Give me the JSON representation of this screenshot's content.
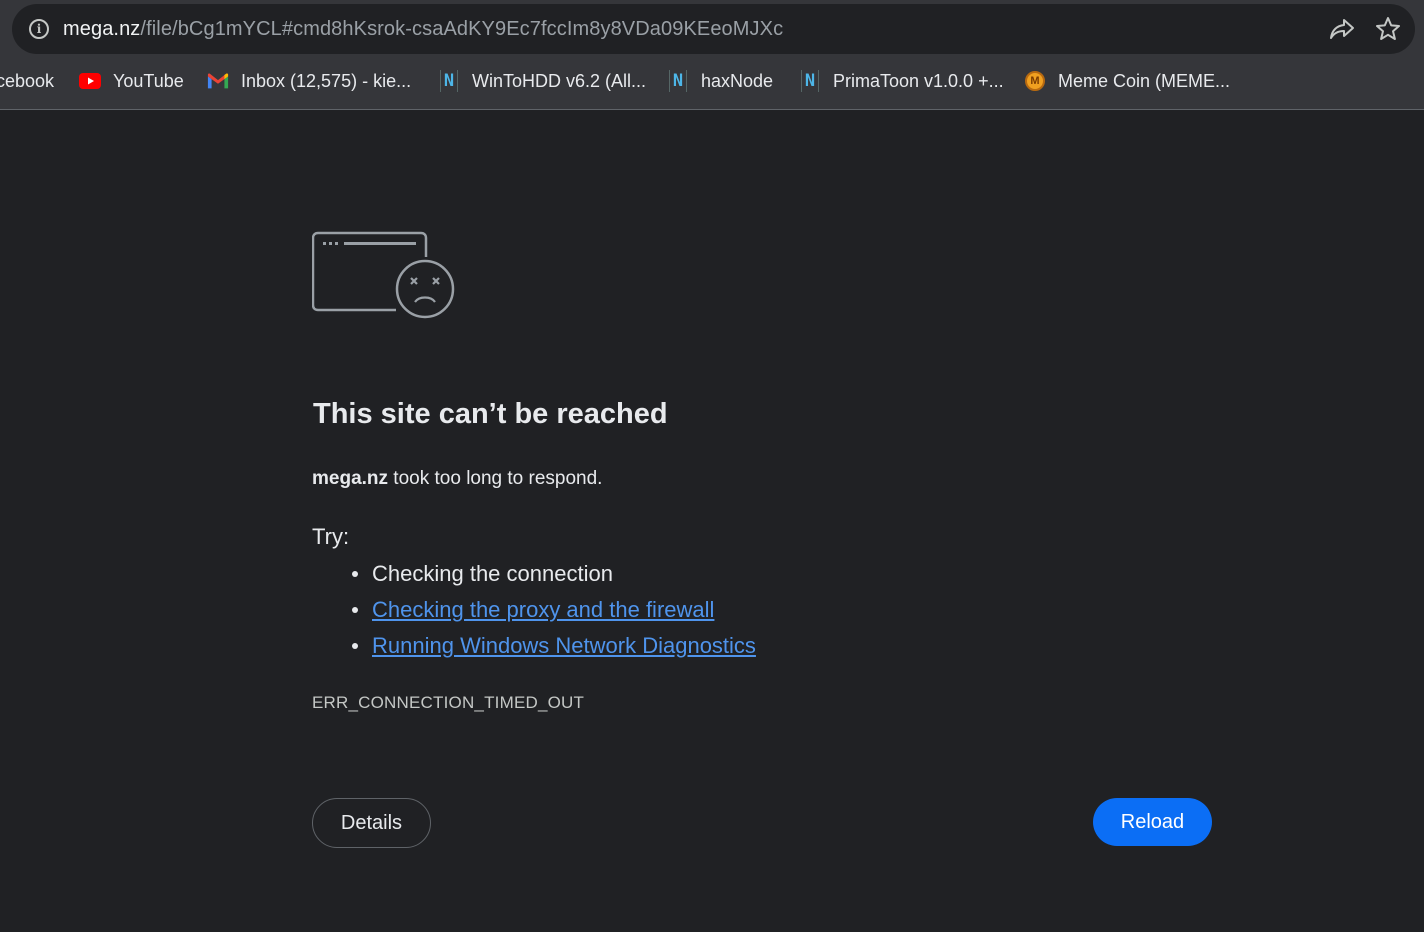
{
  "browser": {
    "url_host": "mega.nz",
    "url_path": "/file/bCg1mYCL#cmd8hKsrok-csaAdKY9Ec7fccIm8y8VDa09KEeoMJXc",
    "icons": {
      "site_info": "info-icon",
      "share": "share-icon",
      "bookmark_star": "star-icon"
    }
  },
  "bookmarks": [
    {
      "label": "cebook",
      "icon": "none"
    },
    {
      "label": "YouTube",
      "icon": "youtube-icon"
    },
    {
      "label": "Inbox (12,575) - kie...",
      "icon": "gmail-icon"
    },
    {
      "label": "WinToHDD v6.2 (All...",
      "icon": "n-icon"
    },
    {
      "label": "haxNode",
      "icon": "n-icon"
    },
    {
      "label": "PrimaToon v1.0.0 +...",
      "icon": "n-icon"
    },
    {
      "label": "Meme Coin (MEME...",
      "icon": "meme-coin-icon"
    }
  ],
  "error": {
    "heading": "This site can’t be reached",
    "host": "mega.nz",
    "summary_rest": " took too long to respond.",
    "try_label": "Try:",
    "suggestions": [
      {
        "text": "Checking the connection",
        "link": false
      },
      {
        "text": "Checking the proxy and the firewall",
        "link": true
      },
      {
        "text": "Running Windows Network Diagnostics",
        "link": true
      }
    ],
    "code": "ERR_CONNECTION_TIMED_OUT",
    "details_label": "Details",
    "reload_label": "Reload"
  },
  "colors": {
    "page_bg": "#202124",
    "chrome_bg": "#35363a",
    "link": "#4f94ec",
    "reload_button": "#0b6ef5"
  }
}
